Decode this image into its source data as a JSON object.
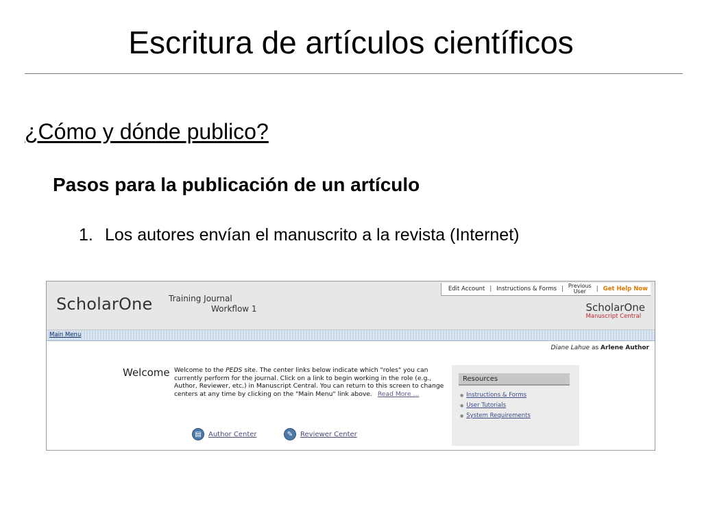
{
  "slide": {
    "title": "Escritura de artículos científicos",
    "section_heading": "¿Cómo y dónde publico?",
    "sub_heading": "Pasos para la publicación de un artículo",
    "step": {
      "number": "1.",
      "text": "Los autores envían el manuscrito a la revista (Internet)"
    }
  },
  "screenshot": {
    "brand_left": "ScholarOne",
    "journal_line1": "Training Journal",
    "journal_line2": "Workflow 1",
    "brand_right": "ScholarOne",
    "brand_right_sub": "Manuscript Central",
    "top_links": {
      "edit_account": "Edit Account",
      "instructions": "Instructions & Forms",
      "previous_user_1": "Previous",
      "previous_user_2": "User",
      "help": "Get Help Now"
    },
    "menu": {
      "main_menu": "Main Menu"
    },
    "user": {
      "name": "Diane Lahue",
      "as": "as",
      "role": "Arlene Author"
    },
    "welcome": {
      "title": "Welcome",
      "text_pre": "Welcome to the ",
      "site": "PEDS",
      "text_post": " site. The center links below indicate which \"roles\" you can currently perform for the journal. Click on a link to begin working in the role (e.g., Author, Reviewer, etc.) in Manuscript Central. You can return to this screen to change centers at any time by clicking on the \"Main Menu\" link above.",
      "read_more": "Read More ..."
    },
    "centers": {
      "author": "Author Center",
      "reviewer": "Reviewer Center"
    },
    "resources": {
      "heading": "Resources",
      "items": [
        "Instructions & Forms",
        "User Tutorials",
        "System Requirements"
      ]
    }
  }
}
